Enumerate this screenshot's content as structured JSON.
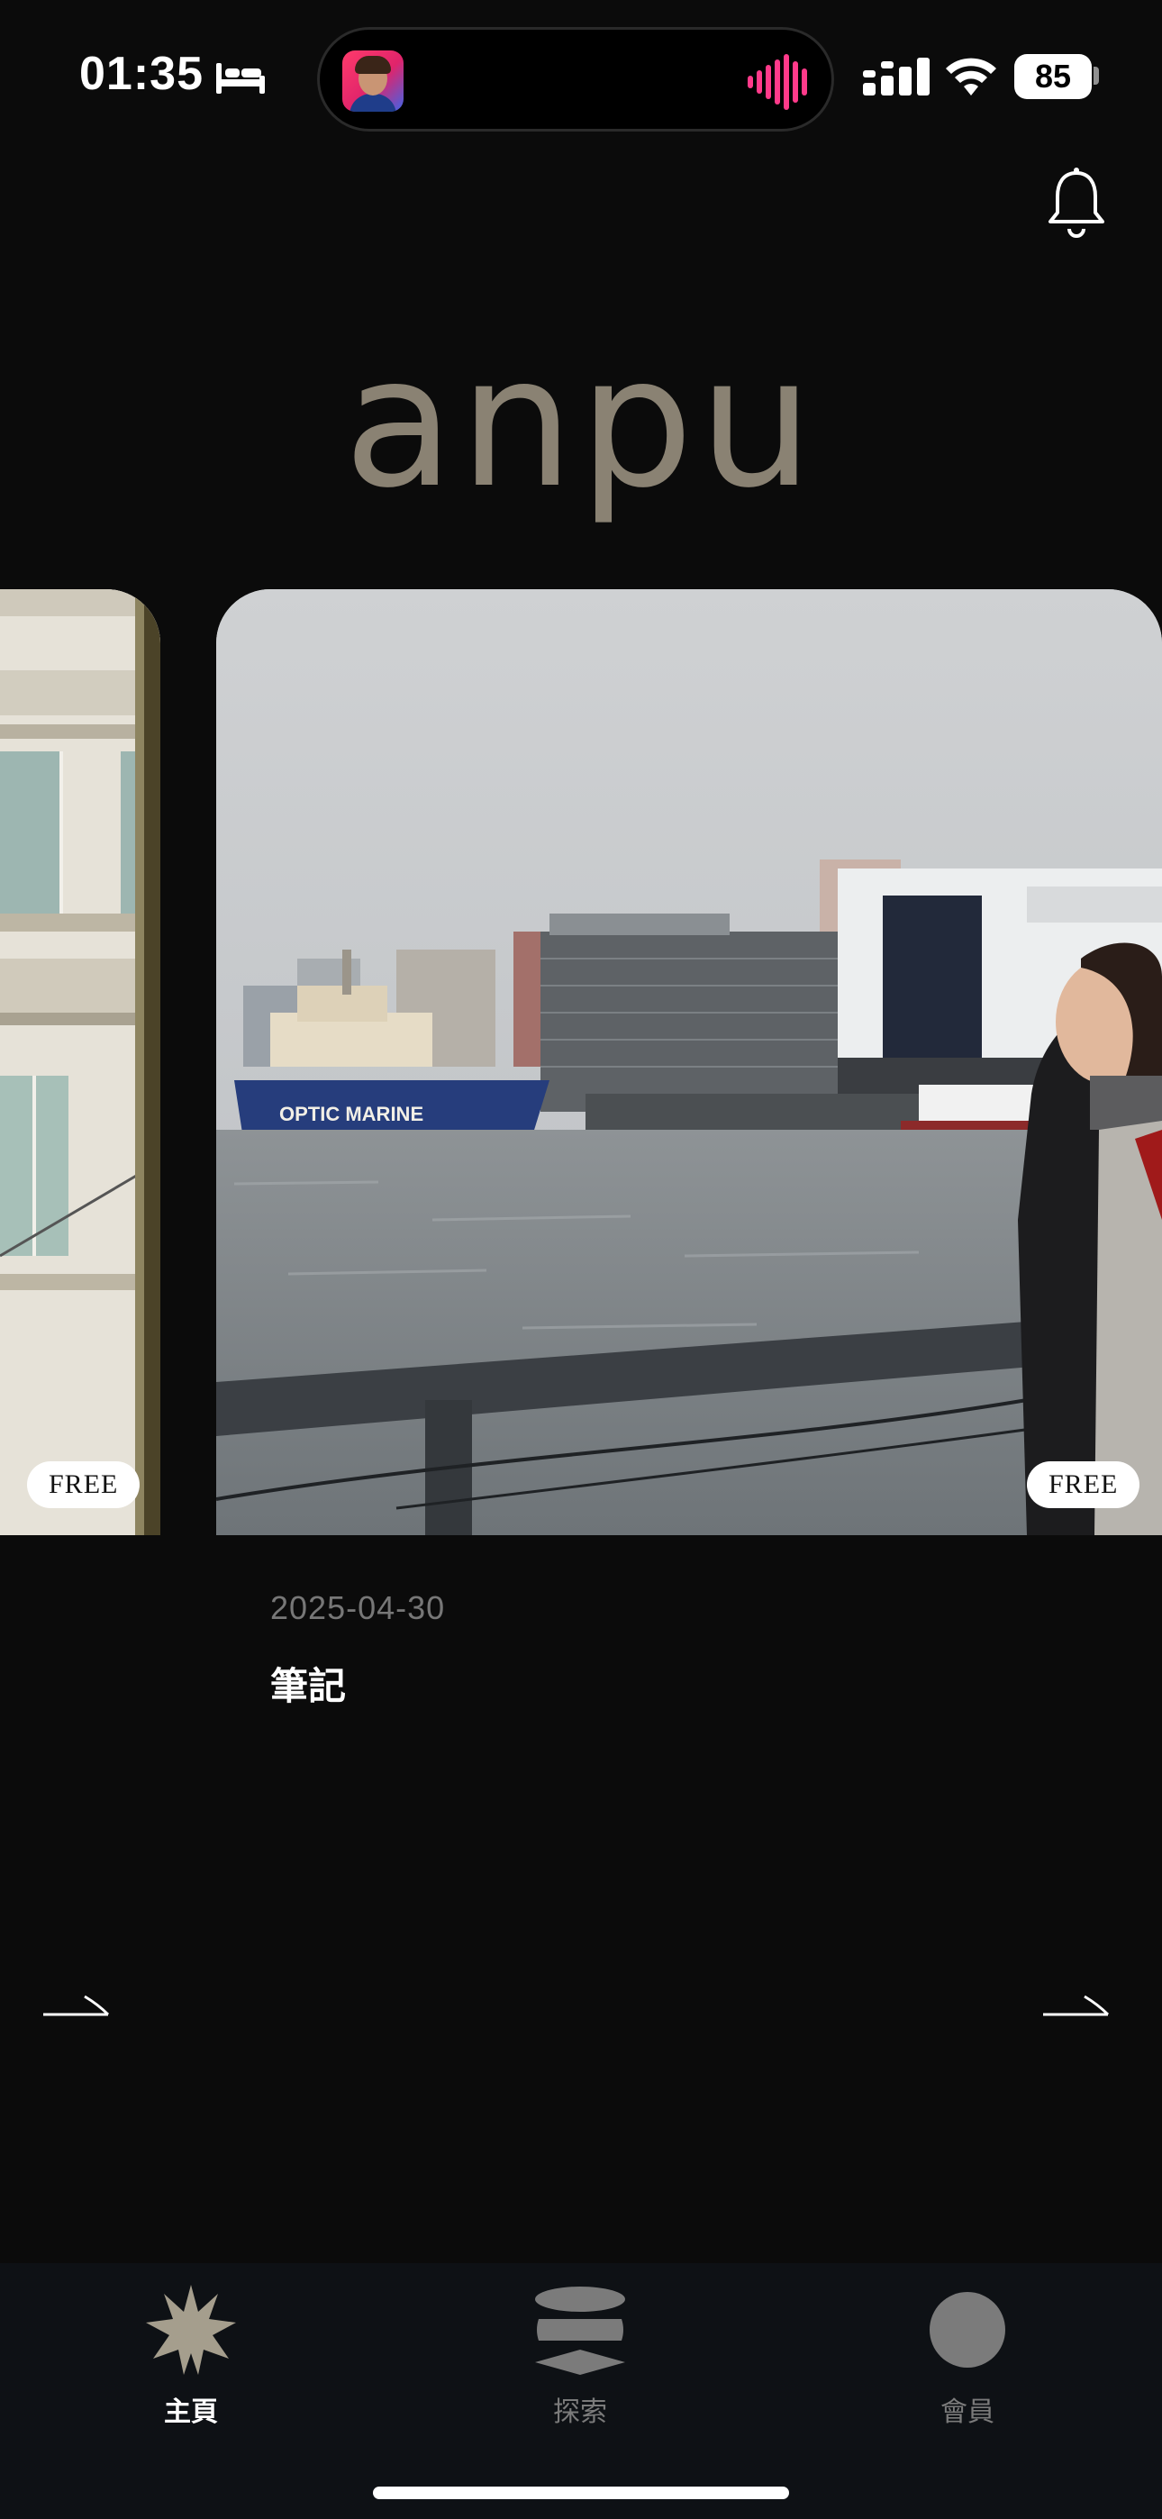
{
  "status_bar": {
    "time": "01:35",
    "battery": "85"
  },
  "header": {
    "logo": "anpu"
  },
  "carousel": {
    "left_card": {
      "badge": "FREE"
    },
    "current_card": {
      "badge": "FREE",
      "date": "2025-04-30",
      "title": "筆記"
    }
  },
  "tabs": [
    {
      "label": "主頁",
      "active": true,
      "icon": "star-burst-icon"
    },
    {
      "label": "探索",
      "active": false,
      "icon": "layers-icon"
    },
    {
      "label": "會員",
      "active": false,
      "icon": "circle-icon"
    }
  ],
  "colors": {
    "background": "#0b0b0b",
    "logo": "#8a8273",
    "tab_bar": "#0e1115",
    "inactive_tab": "#7b7b7b"
  }
}
